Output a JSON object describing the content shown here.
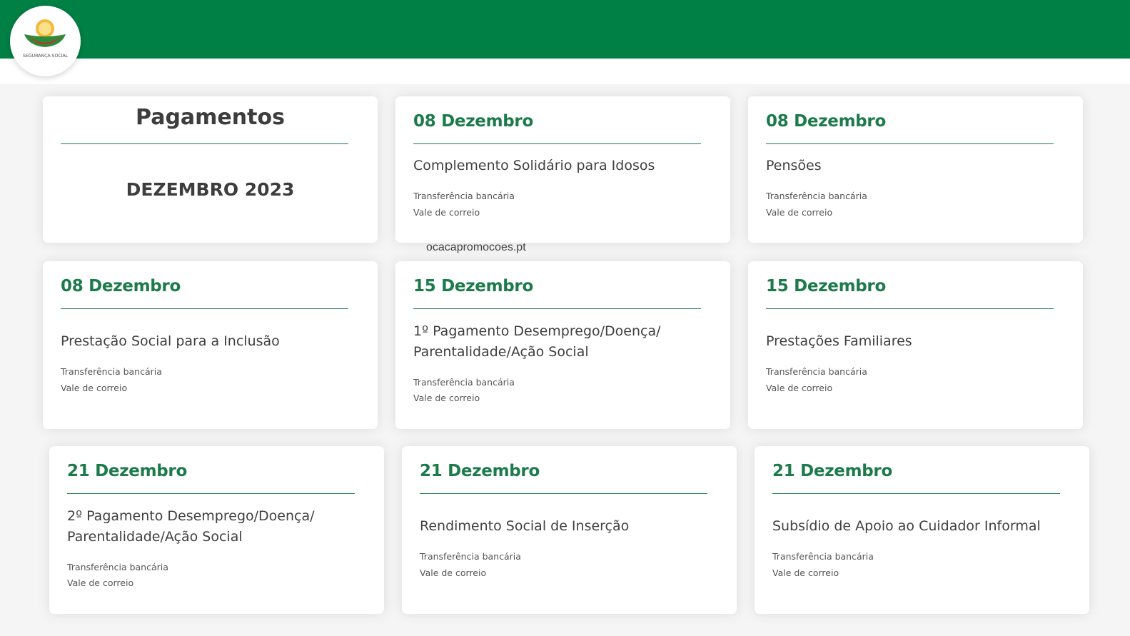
{
  "header": {
    "bar_color": "#008044",
    "logo_text": "SEGURANÇA SOCIAL"
  },
  "accent_color": "#1c7a4b",
  "summary": {
    "title": "Pagamentos",
    "period": "DEZEMBRO 2023"
  },
  "watermark": "ocacapromocoes.pt",
  "cards": [
    {
      "date": "08 Dezembro",
      "name": [
        "Complemento Solidário para Idosos"
      ],
      "methods": [
        "Transferência bancária",
        "Vale de correio"
      ]
    },
    {
      "date": "08 Dezembro",
      "name": [
        "Pensões"
      ],
      "methods": [
        "Transferência bancária",
        "Vale de correio"
      ]
    },
    {
      "date": "08 Dezembro",
      "name": [
        "Prestação Social para a Inclusão"
      ],
      "methods": [
        "Transferência bancária",
        "Vale de correio"
      ]
    },
    {
      "date": "15 Dezembro",
      "name": [
        "1º Pagamento Desemprego/Doença/",
        "Parentalidade/Ação Social"
      ],
      "methods": [
        "Transferência bancária",
        "Vale de correio"
      ]
    },
    {
      "date": "15 Dezembro",
      "name": [
        "Prestações Familiares"
      ],
      "methods": [
        "Transferência bancária",
        "Vale de correio"
      ]
    },
    {
      "date": "21 Dezembro",
      "name": [
        "2º Pagamento Desemprego/Doença/",
        "Parentalidade/Ação Social"
      ],
      "methods": [
        "Transferência bancária",
        "Vale de correio"
      ]
    },
    {
      "date": "21 Dezembro",
      "name": [
        "Rendimento Social de Inserção"
      ],
      "methods": [
        "Transferência bancária",
        "Vale de correio"
      ]
    },
    {
      "date": "21 Dezembro",
      "name": [
        "Subsídio de Apoio ao Cuidador Informal"
      ],
      "methods": [
        "Transferência bancária",
        "Vale de correio"
      ]
    }
  ]
}
